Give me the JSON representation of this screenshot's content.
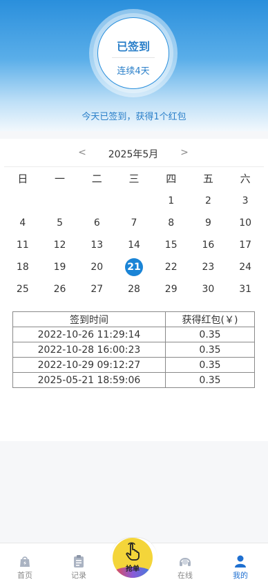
{
  "signin": {
    "status": "已签到",
    "streak": "连续4天",
    "message": "今天已签到，获得1个红包"
  },
  "calendar": {
    "prev_symbol": "<",
    "next_symbol": ">",
    "month_label": "2025年5月",
    "weekdays": [
      "日",
      "一",
      "二",
      "三",
      "四",
      "五",
      "六"
    ],
    "first_weekday_index": 4,
    "days_in_month": 31,
    "today": 21
  },
  "records": {
    "headers": [
      "签到时间",
      "获得红包(￥)"
    ],
    "rows": [
      [
        "2022-10-26 11:29:14",
        "0.35"
      ],
      [
        "2022-10-28 16:00:23",
        "0.35"
      ],
      [
        "2022-10-29 09:12:27",
        "0.35"
      ],
      [
        "2025-05-21 18:59:06",
        "0.35"
      ]
    ]
  },
  "tabbar": {
    "items": [
      {
        "label": "首页",
        "icon": "home-bag-icon"
      },
      {
        "label": "记录",
        "icon": "clipboard-icon"
      },
      {
        "label": "抢单",
        "icon": "tap-hand-icon"
      },
      {
        "label": "在线",
        "icon": "headset-icon"
      },
      {
        "label": "我的",
        "icon": "user-icon"
      }
    ],
    "active_index": 4,
    "accent_color": "#1e6fd0"
  }
}
